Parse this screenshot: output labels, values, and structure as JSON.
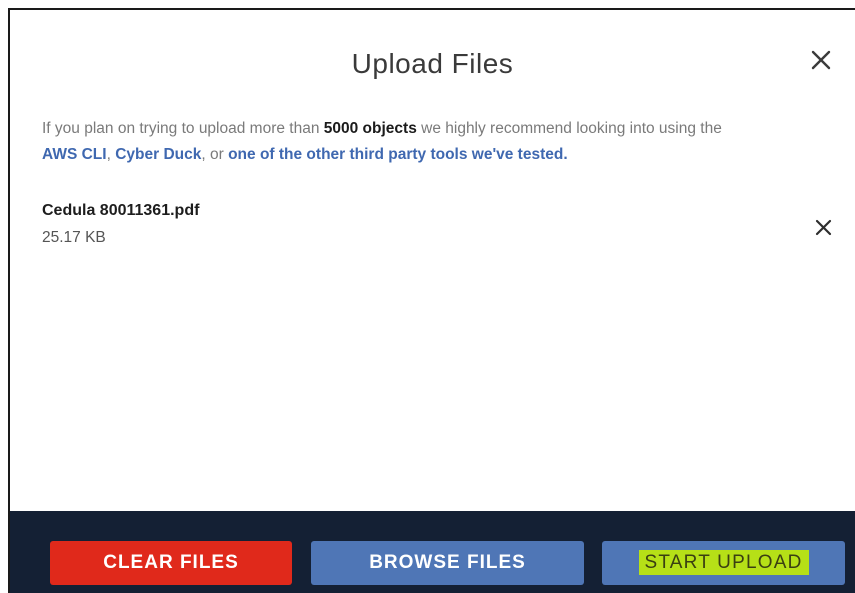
{
  "dialog": {
    "title": "Upload Files"
  },
  "intro": {
    "prefix": "If you plan on trying to upload more than ",
    "highlight": "5000 objects",
    "middle": " we highly recommend looking into using the",
    "link_aws": "AWS CLI",
    "sep1": ", ",
    "link_cyberduck": "Cyber Duck",
    "sep2": ", or ",
    "link_other": "one of the other third party tools we've tested."
  },
  "files": [
    {
      "name": "Cedula 80011361.pdf",
      "size": "25.17 KB"
    }
  ],
  "footer": {
    "clear_label": "CLEAR FILES",
    "browse_label": "BROWSE FILES",
    "start_label": "START UPLOAD"
  },
  "colors": {
    "clear": "#e0291b",
    "primary": "#4f76b6",
    "footer_bg": "#142034",
    "link": "#3f68b0",
    "highlight": "#b6e017"
  },
  "icons": {
    "dialog_close": "close-icon",
    "file_remove": "close-icon"
  }
}
